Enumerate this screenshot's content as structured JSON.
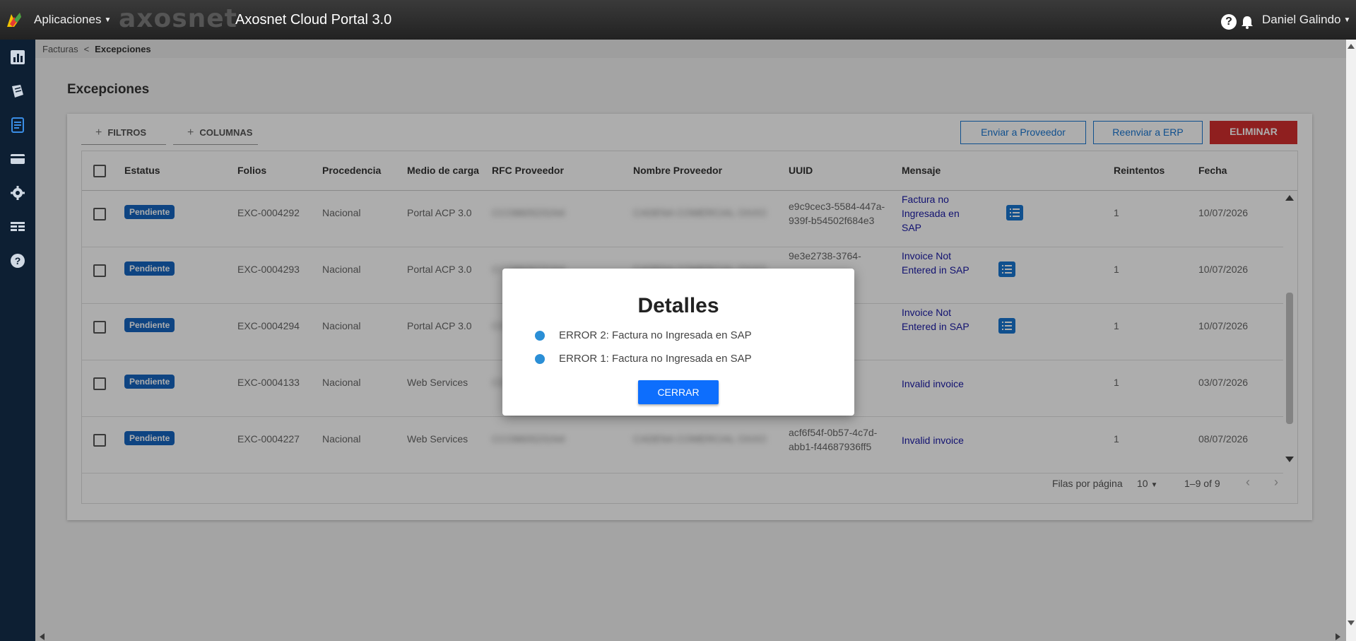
{
  "topbar": {
    "apps_label": "Aplicaciones",
    "brand": "axosnet",
    "portal_title": "Axosnet Cloud Portal 3.0",
    "help": "?",
    "user_name": "Daniel Galindo"
  },
  "breadcrumb": {
    "parent": "Facturas",
    "separator": "<",
    "current": "Excepciones"
  },
  "page_title": "Excepciones",
  "toolbar": {
    "filters": "FILTROS",
    "columns": "COLUMNAS",
    "send_supplier": "Enviar a Proveedor",
    "resend_erp": "Reenviar a ERP",
    "delete": "ELIMINAR"
  },
  "table": {
    "headers": [
      "Estatus",
      "Folios",
      "Procedencia",
      "Medio de carga",
      "RFC Proveedor",
      "Nombre Proveedor",
      "UUID",
      "Mensaje",
      "Reintentos",
      "Fecha"
    ],
    "rows": [
      {
        "status": "Pendiente",
        "folio": "EXC-0004292",
        "procedencia": "Nacional",
        "medio": "Portal ACP 3.0",
        "rfc": "CCO8605231N4",
        "nombre": "CADENA COMERCIAL OXXO",
        "uuid": "e9c9cec3-5584-447a-939f-b54502f684e3",
        "mensaje": "Factura no Ingresada en SAP",
        "reintentos": "1",
        "fecha": "10/07/2026"
      },
      {
        "status": "Pendiente",
        "folio": "EXC-0004293",
        "procedencia": "Nacional",
        "medio": "Portal ACP 3.0",
        "rfc": "CCO8605231N4",
        "nombre": "CADENA COMERCIAL OXXO",
        "uuid": "9e3e2738-3764-",
        "mensaje": "Invoice Not Entered in SAP",
        "reintentos": "1",
        "fecha": "10/07/2026"
      },
      {
        "status": "Pendiente",
        "folio": "EXC-0004294",
        "procedencia": "Nacional",
        "medio": "Portal ACP 3.0",
        "rfc": "CC",
        "nombre": "",
        "uuid": "0-",
        "mensaje": "Invoice Not Entered in SAP",
        "reintentos": "1",
        "fecha": "10/07/2026"
      },
      {
        "status": "Pendiente",
        "folio": "EXC-0004133",
        "procedencia": "Nacional",
        "medio": "Web Services",
        "rfc": "CC",
        "nombre": "",
        "uuid": "d-",
        "mensaje": "Invalid invoice",
        "reintentos": "1",
        "fecha": "03/07/2026"
      },
      {
        "status": "Pendiente",
        "folio": "EXC-0004227",
        "procedencia": "Nacional",
        "medio": "Web Services",
        "rfc": "CCO8605231N4",
        "nombre": "CADENA COMERCIAL OXXO",
        "uuid": "acf6f54f-0b57-4c7d-abb1-f44687936ff5",
        "mensaje": "Invalid invoice",
        "reintentos": "1",
        "fecha": "08/07/2026"
      }
    ]
  },
  "pager": {
    "rows_label": "Filas por página",
    "rows_value": "10",
    "range": "1–9 of 9"
  },
  "modal": {
    "title": "Detalles",
    "items": [
      "ERROR 2: Factura no Ingresada en SAP",
      "ERROR 1: Factura no Ingresada en SAP"
    ],
    "close": "CERRAR"
  },
  "colors": {
    "topbar": "#2b2b2b",
    "sidebar": "#0d1f33",
    "accent": "#1976d2",
    "danger": "#d32f2f",
    "badge": "#1565c0"
  }
}
